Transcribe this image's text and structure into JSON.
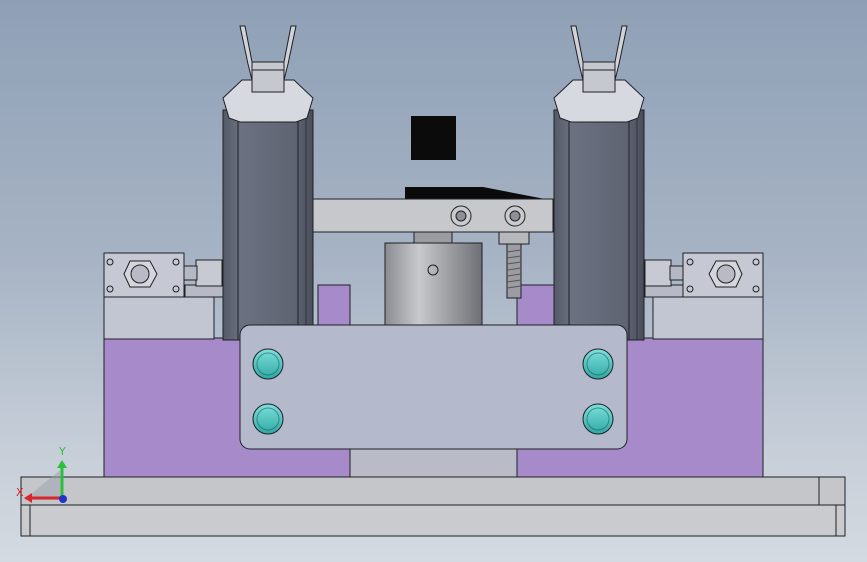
{
  "view": {
    "background_top": "#8fa0b6",
    "background_bottom": "#d4dae1"
  },
  "colors": {
    "purple_block": "#a78ac9",
    "steel_light": "#c2c6d2",
    "steel_mid": "#a9adba",
    "cylinder_dark": "#6a6e7c",
    "bolt_teal": "#4fc9c4",
    "edge": "#1f2024",
    "black_part": "#0b0b0b"
  },
  "triad": {
    "x_label": "X",
    "y_label": "Y",
    "x_color": "#d8262a",
    "y_color": "#2bbf3c",
    "z_color": "#2233cc"
  },
  "icons": [
    "triad-icon"
  ]
}
